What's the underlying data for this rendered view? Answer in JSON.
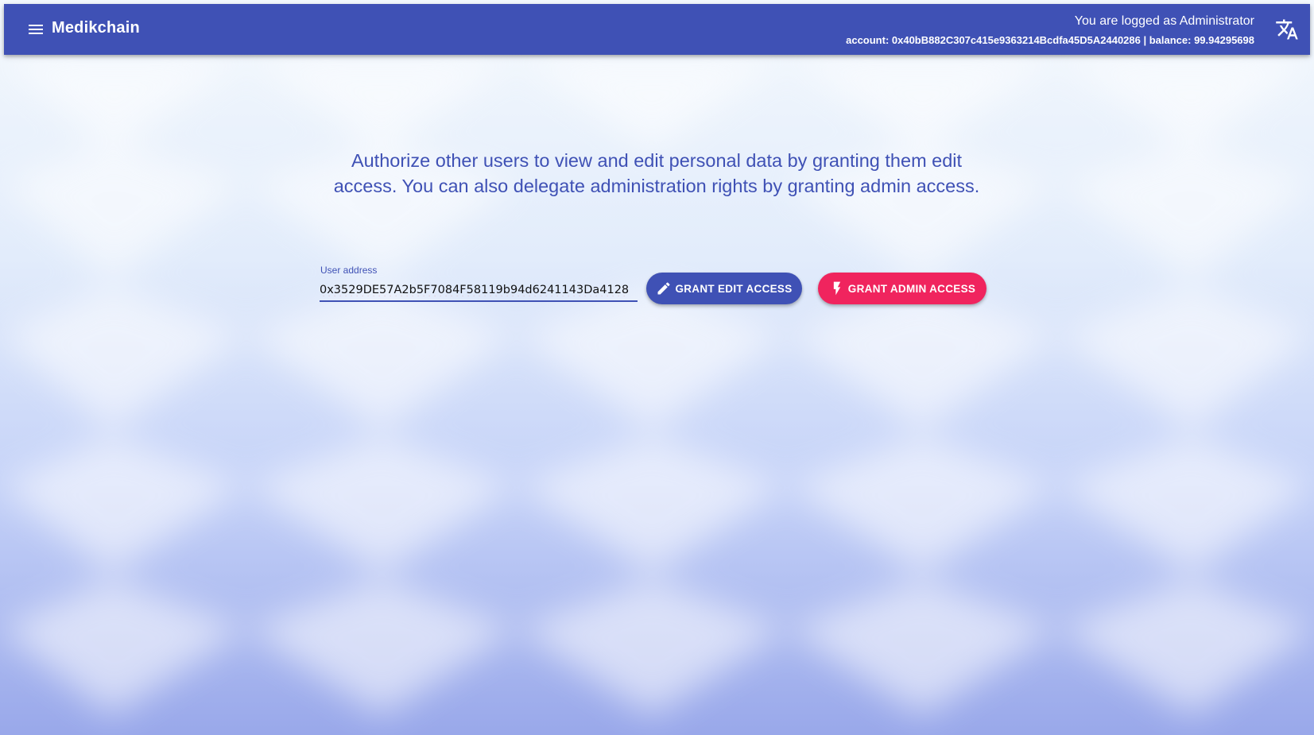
{
  "toolbar": {
    "app_title": "Medikchain",
    "login_status": "You are logged as Administrator",
    "account_line": "account: 0x40bB882C307c415e9363214Bcdfa45D5A2440286 | balance: 99.94295698",
    "menu_icon": "menu-icon",
    "translate_icon": "translate-icon",
    "color": "#3f51b5"
  },
  "main": {
    "intro_text": "Authorize other users to view and edit personal data by granting them edit access. You can also delegate administration rights by granting admin access.",
    "address_field": {
      "label": "User address",
      "value": "0x3529DE57A2b5F7084F58119b94d6241143Da4128"
    },
    "buttons": {
      "grant_edit": {
        "label": "GRANT EDIT ACCESS",
        "icon": "pencil-icon",
        "color": "#3f51b5"
      },
      "grant_admin": {
        "label": "GRANT ADMIN ACCESS",
        "icon": "flash-icon",
        "color": "#f0245e"
      }
    }
  }
}
